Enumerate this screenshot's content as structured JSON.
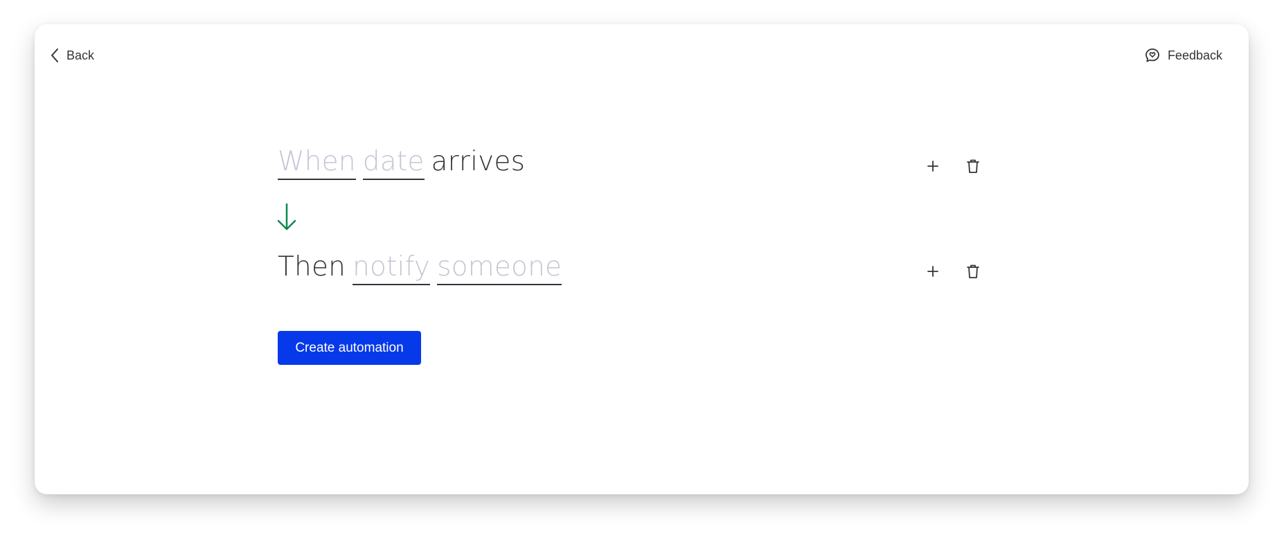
{
  "header": {
    "back_label": "Back",
    "feedback_label": "Feedback"
  },
  "trigger": {
    "token_1": "When",
    "token_2": "date",
    "word": "arrives"
  },
  "action": {
    "word": "Then",
    "token_1": "notify",
    "token_2": "someone"
  },
  "primary_button": {
    "label": "Create automation"
  },
  "icons": {
    "back": "chevron-left-icon",
    "feedback": "feedback-chat-heart-icon",
    "flow": "arrow-down-icon",
    "add": "plus-icon",
    "delete": "trash-icon"
  },
  "colors": {
    "accent": "#0639e9",
    "flow_arrow": "#0b8a4a",
    "token_placeholder": "#c3c6d4",
    "text": "#323338"
  }
}
